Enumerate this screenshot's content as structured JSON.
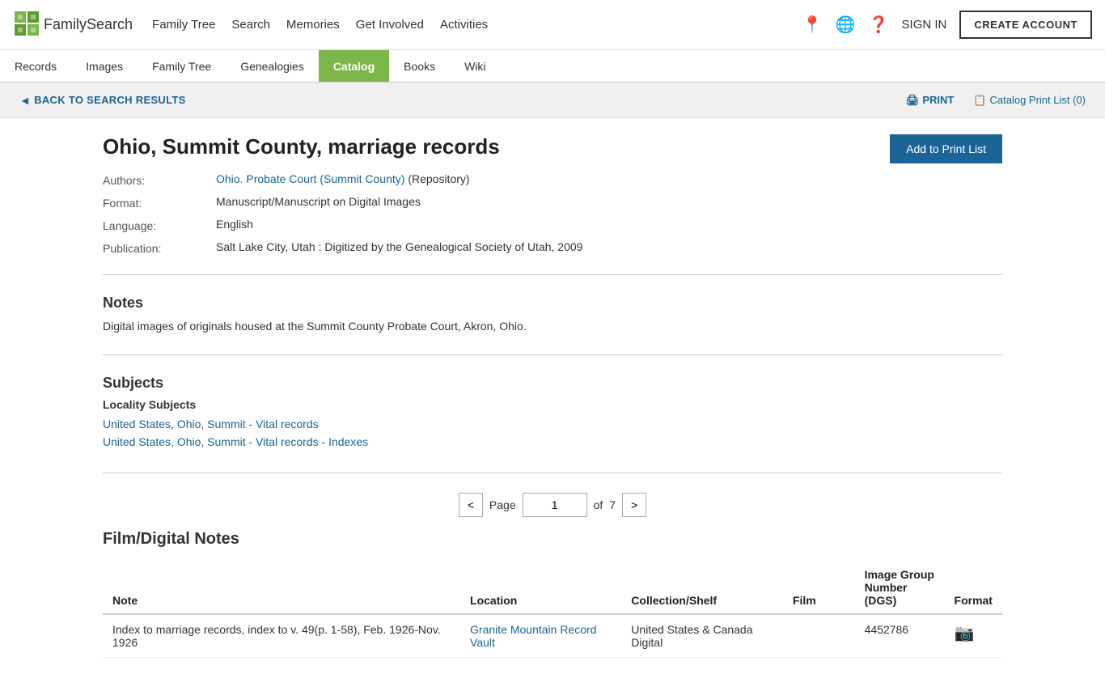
{
  "header": {
    "logo_text": "FamilySearch",
    "nav_items": [
      {
        "label": "Family Tree",
        "id": "family-tree"
      },
      {
        "label": "Search",
        "id": "search"
      },
      {
        "label": "Memories",
        "id": "memories"
      },
      {
        "label": "Get Involved",
        "id": "get-involved"
      },
      {
        "label": "Activities",
        "id": "activities"
      }
    ],
    "sign_in_label": "SIGN IN",
    "create_account_label": "CREATE ACCOUNT"
  },
  "subnav": {
    "items": [
      {
        "label": "Records",
        "id": "records",
        "active": false
      },
      {
        "label": "Images",
        "id": "images",
        "active": false
      },
      {
        "label": "Family Tree",
        "id": "family-tree",
        "active": false
      },
      {
        "label": "Genealogies",
        "id": "genealogies",
        "active": false
      },
      {
        "label": "Catalog",
        "id": "catalog",
        "active": true
      },
      {
        "label": "Books",
        "id": "books",
        "active": false
      },
      {
        "label": "Wiki",
        "id": "wiki",
        "active": false
      }
    ]
  },
  "back_bar": {
    "back_label": "BACK TO SEARCH RESULTS",
    "print_label": "PRINT",
    "catalog_print_label": "Catalog Print List (0)"
  },
  "record": {
    "title": "Ohio, Summit County, marriage records",
    "add_print_label": "Add to Print List",
    "fields": {
      "authors_label": "Authors:",
      "authors_value": "Ohio. Probate Court (Summit County)",
      "authors_suffix": "(Repository)",
      "format_label": "Format:",
      "format_value": "Manuscript/Manuscript on Digital Images",
      "language_label": "Language:",
      "language_value": "English",
      "publication_label": "Publication:",
      "publication_value": "Salt Lake City, Utah : Digitized by the Genealogical Society of Utah, 2009"
    }
  },
  "notes": {
    "title": "Notes",
    "text": "Digital images of originals housed at the Summit County Probate Court, Akron, Ohio."
  },
  "subjects": {
    "title": "Subjects",
    "subsection_title": "Locality Subjects",
    "links": [
      {
        "label": "United States, Ohio, Summit - Vital records"
      },
      {
        "label": "United States, Ohio, Summit - Vital records - Indexes"
      }
    ]
  },
  "pagination": {
    "prev_label": "<",
    "next_label": ">",
    "page_label": "Page",
    "current_page": "1",
    "of_label": "of",
    "total_pages": "7"
  },
  "film_section": {
    "title": "Film/Digital Notes",
    "table": {
      "headers": [
        "Note",
        "Location",
        "Collection/Shelf",
        "Film",
        "Image Group Number (DGS)",
        "Format"
      ],
      "rows": [
        {
          "note": "Index to marriage records, index to v. 49(p. 1-58), Feb. 1926-Nov. 1926",
          "location": "Granite Mountain Record Vault",
          "collection": "United States & Canada Digital",
          "film": "",
          "dgs": "4452786",
          "format": "camera"
        }
      ]
    }
  }
}
